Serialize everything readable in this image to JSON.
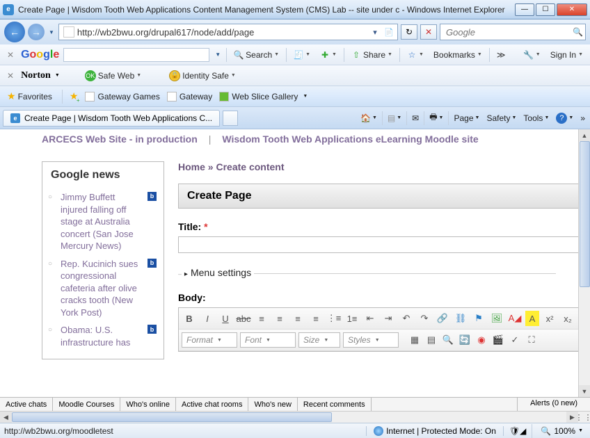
{
  "window": {
    "title": "Create Page | Wisdom Tooth Web Applications Content Management System (CMS) Lab -- site under c - Windows Internet Explorer"
  },
  "nav": {
    "url": "http://wb2bwu.org/drupal617/node/add/page",
    "search_placeholder": "Google"
  },
  "google_toolbar": {
    "search": "Search",
    "share": "Share",
    "bookmarks": "Bookmarks",
    "signin": "Sign In"
  },
  "norton_toolbar": {
    "brand": "Norton",
    "safe_web": "Safe Web",
    "identity_safe": "Identity Safe"
  },
  "favorites": {
    "label": "Favorites",
    "links": [
      "Gateway Games",
      "Gateway",
      "Web Slice Gallery"
    ]
  },
  "tab": {
    "title": "Create Page | Wisdom Tooth Web Applications C..."
  },
  "commandbar": {
    "page": "Page",
    "safety": "Safety",
    "tools": "Tools"
  },
  "site": {
    "toplinks": [
      "ARCECS Web Site - in production",
      "Wisdom Tooth Web Applications eLearning Moodle site"
    ],
    "breadcrumb": {
      "home": "Home",
      "sep": "»",
      "current": "Create content"
    },
    "panel_title": "Create Page",
    "title_label": "Title:",
    "menu_settings": "Menu settings",
    "body_label": "Body:",
    "editor_dropdowns": {
      "format": "Format",
      "font": "Font",
      "size": "Size",
      "styles": "Styles"
    }
  },
  "news_block": {
    "title": "Google news",
    "items": [
      "Jimmy Buffett injured falling off stage at Australia concert (San Jose Mercury News)",
      "Rep. Kucinich sues congressional cafeteria after olive cracks tooth (New York Post)",
      "Obama: U.S. infrastructure has"
    ]
  },
  "bottom_tabs": [
    "Active chats",
    "Moodle Courses",
    "Who's online",
    "Active chat rooms",
    "Who's new",
    "Recent comments"
  ],
  "alerts": "Alerts (0 new)",
  "statusbar": {
    "url": "http://wb2bwu.org/moodletest",
    "zone": "Internet | Protected Mode: On",
    "zoom": "100%"
  }
}
